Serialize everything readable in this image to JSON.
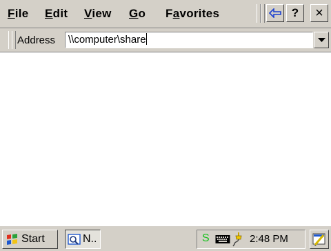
{
  "menubar": {
    "items": [
      {
        "label": "File",
        "accel": "F"
      },
      {
        "label": "Edit",
        "accel": "E"
      },
      {
        "label": "View",
        "accel": "V"
      },
      {
        "label": "Go",
        "accel": "G"
      },
      {
        "label": "Favorites",
        "accel": "a"
      }
    ],
    "help_label": "?",
    "close_label": "×"
  },
  "address_bar": {
    "label": "Address",
    "value": "\\\\computer\\share"
  },
  "taskbar": {
    "start_label": "Start",
    "task_label": "N..",
    "tray_s": "S",
    "clock": "2:48 PM"
  },
  "colors": {
    "chrome": "#d4d0c8",
    "back_arrow": "#1a3fd0",
    "tray_s": "#16c11c"
  }
}
